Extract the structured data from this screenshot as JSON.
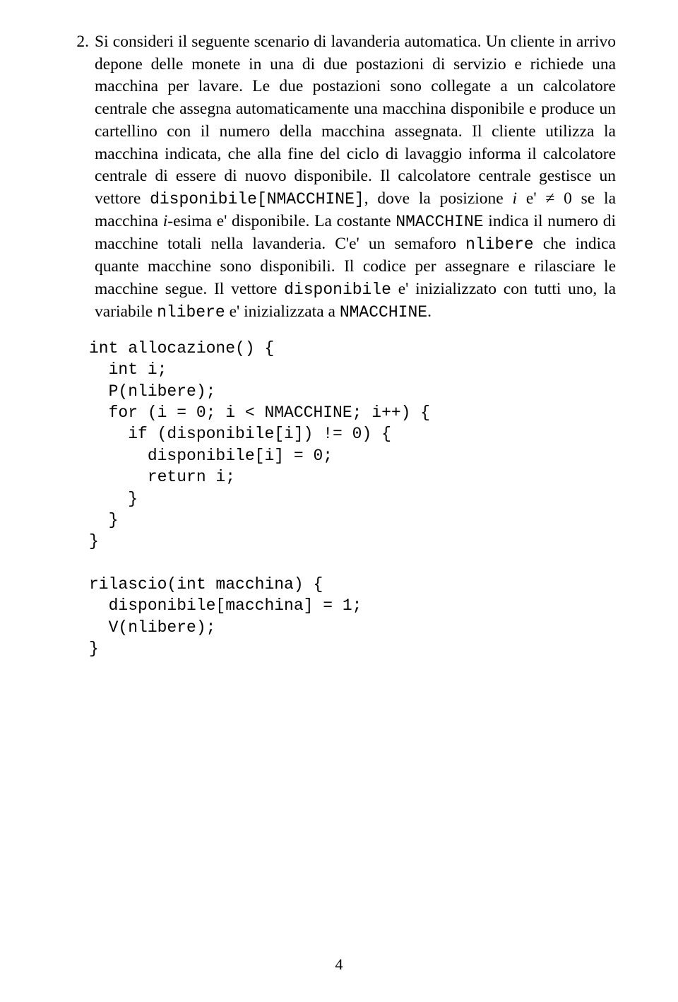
{
  "item_number": "2.",
  "para": {
    "s1": "Si consideri il seguente scenario di lavanderia automatica. Un cliente in arrivo depone delle monete in una di due postazioni di servizio e richiede una macchina per lavare. Le due postazioni sono collegate a un calcolatore centrale che assegna automaticamente una macchina disponibile e produce un cartellino con il numero della macchina assegnata. Il cliente utilizza la macchina indicata, che alla fine del ciclo di lavaggio informa il calcolatore centrale di essere di nuovo disponibile. Il calcolatore centrale gestisce un vettore ",
    "code1": "disponibile[NMACCHINE]",
    "s2": ", dove la posizione ",
    "i1": "i",
    "s3": " e' ",
    "neq": "≠",
    "zero": " 0",
    "s4": " se la macchina ",
    "i2": "i",
    "s5": "-esima e' disponibile. La costante ",
    "code2": "NMACCHINE",
    "s6": " indica il numero di macchine totali nella lavanderia. C'e' un semaforo ",
    "code3": "nlibere",
    "s7": " che indica quante macchine sono disponibili. Il codice per assegnare e rilasciare le macchine segue. Il vettore ",
    "code4": "disponibile",
    "s8": " e' inizializzato con tutti uno, la variabile ",
    "code5": "nlibere",
    "s9": " e' inizializzata a ",
    "code6": "NMACCHINE",
    "s10": "."
  },
  "code": "int allocazione() {\n  int i;\n  P(nlibere);\n  for (i = 0; i < NMACCHINE; i++) {\n    if (disponibile[i]) != 0) {\n      disponibile[i] = 0;\n      return i;\n    }\n  }\n}\n\nrilascio(int macchina) {\n  disponibile[macchina] = 1;\n  V(nlibere);\n}",
  "page_number": "4"
}
